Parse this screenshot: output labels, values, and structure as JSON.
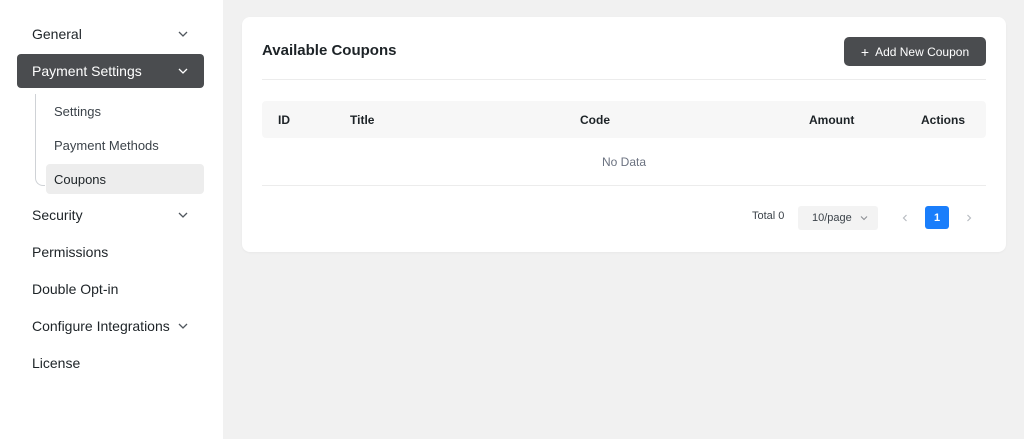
{
  "sidebar": {
    "items": [
      {
        "label": "General",
        "has_chevron": true
      },
      {
        "label": "Payment Settings",
        "has_chevron": true,
        "active": true
      },
      {
        "label": "Security",
        "has_chevron": true
      },
      {
        "label": "Permissions",
        "has_chevron": false
      },
      {
        "label": "Double Opt-in",
        "has_chevron": false
      },
      {
        "label": "Configure Integrations",
        "has_chevron": true
      },
      {
        "label": "License",
        "has_chevron": false
      }
    ],
    "subitems": [
      {
        "label": "Settings"
      },
      {
        "label": "Payment Methods"
      },
      {
        "label": "Coupons",
        "active": true
      }
    ]
  },
  "main": {
    "title": "Available Coupons",
    "add_button_label": "Add New Coupon",
    "table": {
      "columns": [
        "ID",
        "Title",
        "Code",
        "Amount",
        "Actions"
      ],
      "rows": [],
      "empty_text": "No Data"
    },
    "pagination": {
      "total_text": "Total 0",
      "page_size": "10/page",
      "current_page": "1"
    }
  },
  "colors": {
    "sidebar_active_bg": "#4a4c4f",
    "primary_blue": "#1a7efb",
    "page_bg": "#f1f1f1"
  }
}
